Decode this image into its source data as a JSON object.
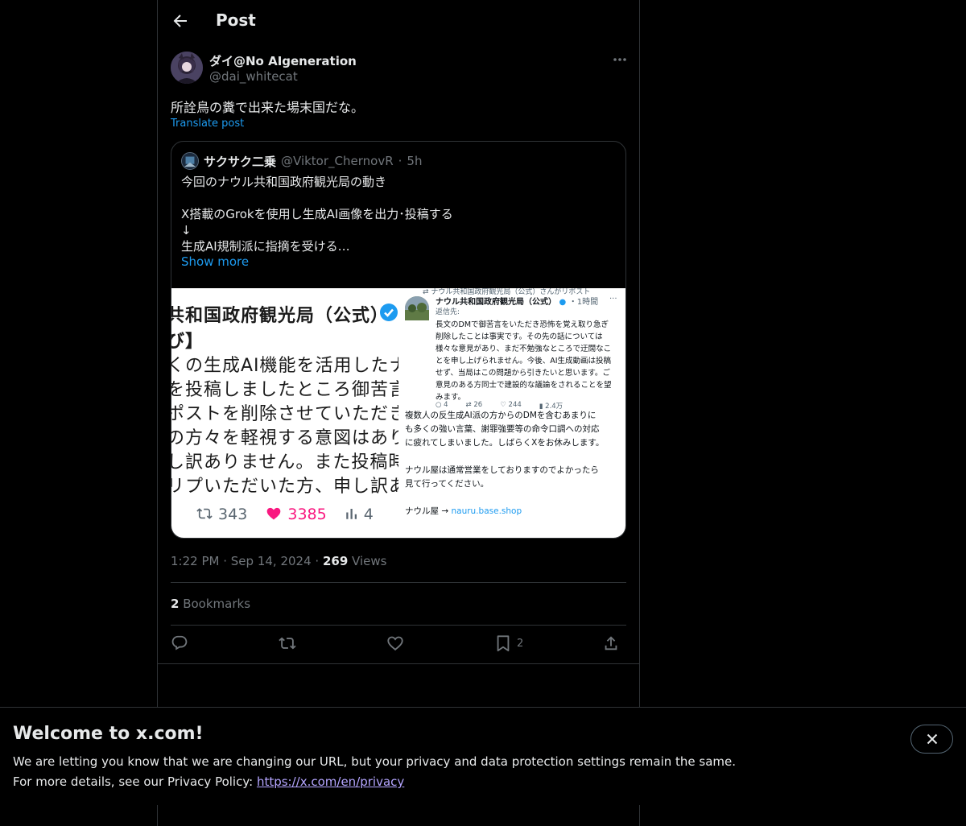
{
  "header": {
    "title": "Post"
  },
  "post": {
    "author_name": "ダイ@No AIgeneration",
    "author_handle": "@dai_whitecat",
    "text": "所詮鳥の糞で出来た場末国だな。",
    "translate_label": "Translate post",
    "time": "1:22 PM",
    "date": "Sep 14, 2024",
    "views_count": "269",
    "views_label": "Views",
    "bookmarks_count": "2",
    "bookmarks_label": "Bookmarks",
    "bookmark_action_count": "2"
  },
  "quote": {
    "name": "サクサク二乗",
    "handle": "@Viktor_ChernovR",
    "age": "5h",
    "lines": [
      "今回のナウル共和国政府観光局の動き",
      "",
      "X搭載のGrokを使用し生成AI画像を出力･投稿する",
      "↓",
      "生成AI規制派に指摘を受ける…"
    ],
    "show_more": "Show more"
  },
  "image_left": {
    "lines": [
      "共和国政府観光局（公式）",
      "び】",
      "くの生成AI機能を活用したナウ",
      "を投稿しましたところ御苦言を",
      "ポストを削除させていただきま",
      "の方々を軽視する意図はありま",
      "し訳ありません。また投稿時に",
      "リプいただいた方、申し訳あり"
    ],
    "retweets": "343",
    "likes": "3385",
    "views": "4"
  },
  "image_right": {
    "repost_line": "ナウル共和国政府観光局（公式）さんがリポスト",
    "name": "ナウル共和国政府観光局（公式）",
    "age": "・1時間",
    "reply_to": "返信先:",
    "body_lines": [
      "長文のDMで御苦言をいただき恐怖を覚え取り急ぎ",
      "削除したことは事実です。その先の話については",
      "様々な意見があり、まだ不勉強なところで迂闊なこ",
      "とを申し上げられません。今後、AI生成動画は投稿",
      "せず、当局はこの問題から引きたいと思います。ご",
      "意見のある方同士で建設的な議論をされることを望",
      "みます。"
    ],
    "stat_replies": "4",
    "stat_retweets": "26",
    "stat_likes": "244",
    "stat_views": "2.4万",
    "lower_lines": [
      "複数人の反生成AI派の方からのDMを含むあまりに",
      "も多くの強い言葉、謝罪強要等の命令口調への対応",
      "に疲れてしまいました。しばらくXをお休みします。",
      "",
      "ナウル屋は通常営業をしておりますのでよかったら",
      "見て行ってください。",
      ""
    ],
    "shop_prefix": "ナウル屋 → ",
    "shop_link": "nauru.base.shop"
  },
  "banner": {
    "title": "Welcome to x.com!",
    "line1": "We are letting you know that we are changing our URL, but your privacy and data protection settings remain the same.",
    "line2_prefix": "For more details, see our Privacy Policy: ",
    "link": "https://x.com/en/privacy"
  },
  "colors": {
    "accent": "#1d9bf0",
    "like": "#f91880",
    "muted": "#71767b",
    "text": "#e7e9ea",
    "border": "#2f3336"
  }
}
